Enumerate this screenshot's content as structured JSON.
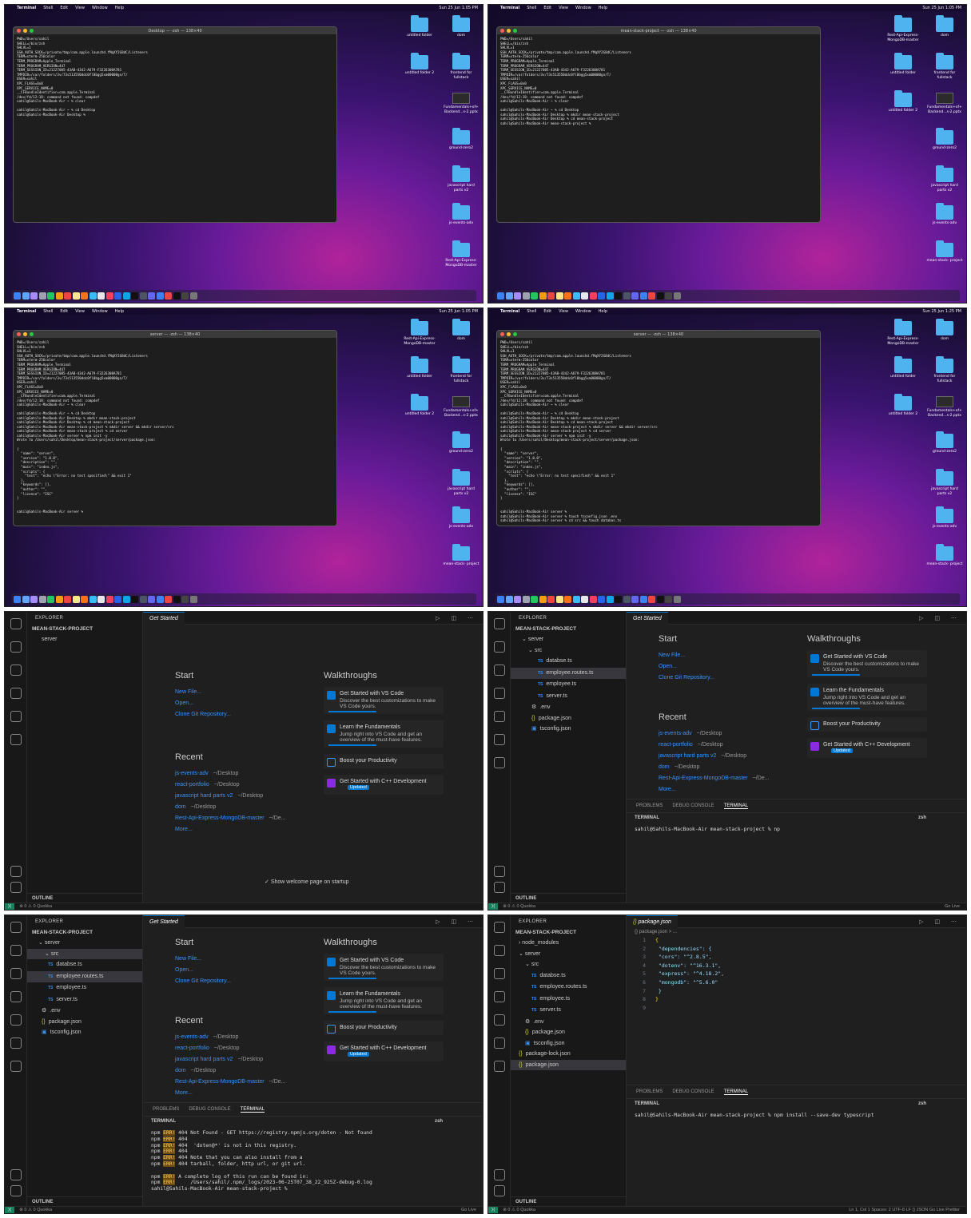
{
  "mac": {
    "menu": [
      "Terminal",
      "Shell",
      "Edit",
      "View",
      "Window",
      "Help"
    ],
    "clock": "Sun 25 Jun  1:05 PM",
    "clock2": "Sun 25 Jun  1:25 PM"
  },
  "frames": {
    "f1_title": "Desktop — -zsh — 138×40",
    "f2_title": "mean-stack-project — -zsh — 138×40",
    "f3_title": "server — -zsh — 138×40",
    "f4_title": "server — -zsh — 138×40",
    "env": "PWD=/Users/sahil\nSHELL=/bin/zsh\nSHLVL=1\nSSH_AUTH_SOCK=/private/tmp/com.apple.launchd.fMqXY2G8dC/Listeners\nTERM=xterm-256color\nTERM_PROGRAM=Apple_Terminal\nTERM_PROGRAM_VERSION=447\nTERM_SESSION_ID=21227085-43AB-4342-A679-F3226308A781\nTMPDIR=/var/folders/3v/73s513550ddc0fl0bgg5xm00000gn/T/\nUSER=sahil\nXPC_FLAGS=0x0\nXPC_SERVICE_NAME=0\n__CFBundleIdentifier=com.apple.Terminal\n/dev/fd/12:18: command not found: compdef\nsahil@Sahils-MacBook-Air ~ % clear",
    "f1_cmd": "sahil@Sahils-MacBook-Air ~ % cd Desktop\nsahil@Sahils-MacBook-Air Desktop % ",
    "f2_cmd": "sahil@Sahils-MacBook-Air ~ % cd Desktop\nsahil@Sahils-MacBook-Air Desktop % mkdir mean-stack-project\nsahil@Sahils-MacBook-Air Desktop % cd mean-stack-project\nsahil@Sahils-MacBook-Air mean-stack-project % ",
    "f3_cmd": "sahil@Sahils-MacBook-Air ~ % cd Desktop\nsahil@Sahils-MacBook-Air Desktop % mkdir mean-stack-project\nsahil@Sahils-MacBook-Air Desktop % cd mean-stack-project\nsahil@Sahils-MacBook-Air mean-stack-project % mkdir server && mkdir server/src\nsahil@Sahils-MacBook-Air mean-stack-project % cd server\nsahil@Sahils-MacBook-Air server % npm init -y\nWrote to /Users/sahil/Desktop/mean-stack-project/server/package.json:\n\n{\n  \"name\": \"server\",\n  \"version\": \"1.0.0\",\n  \"description\": \"\",\n  \"main\": \"index.js\",\n  \"scripts\": {\n    \"test\": \"echo \\\"Error: no test specified\\\" && exit 1\"\n  },\n  \"keywords\": [],\n  \"author\": \"\",\n  \"license\": \"ISC\"\n}\n\n\nsahil@Sahils-MacBook-Air server % ",
    "f4_extra": "sahil@Sahils-MacBook-Air server % touch tsconfig.json .env\nsahil@Sahils-MacBook-Air server % cd src && touch databas.ts"
  },
  "desktop": {
    "a": [
      "untitled folder",
      "dom",
      "untitled folder 2",
      "frontend for fullstack",
      "Fundamentals+of+ Backend...s-2.pptx",
      "ground-zero2",
      "javascript hard parts v2",
      "js-events-adv",
      "Rest-Api-Express- MongoDB-master"
    ],
    "b": [
      "Rest-Api-Express- MongoDB-master",
      "dom",
      "untitled folder",
      "frontend for fullstack",
      "untitled folder 2",
      "Fundamentals+of+ Backend...s-2.pptx",
      "ground-zero2",
      "javascript hard parts v2",
      "js-events-adv",
      "mean-stack- project"
    ]
  },
  "vscode": {
    "explorer": "EXPLORER",
    "project": "MEAN-STACK-PROJECT",
    "tab": "Get Started",
    "tab2": "package.json",
    "outline": "OUTLINE",
    "server": "server",
    "src": "src",
    "node_modules": "node_modules",
    "files": [
      "databse.ts",
      "employee.routes.ts",
      "employee.ts",
      "server.ts"
    ],
    "env": ".env",
    "pkg": "package.json",
    "tsconfig": "tsconfig.json",
    "lock": "package-lock.json",
    "start": "Start",
    "new_file": "New File...",
    "open": "Open...",
    "clone": "Clone Git Repository...",
    "recent": "Recent",
    "recent_items": [
      [
        "js-events-adv",
        "~/Desktop"
      ],
      [
        "react-portfolio",
        "~/Desktop"
      ],
      [
        "javascript hard parts v2",
        "~/Desktop"
      ],
      [
        "dom",
        "~/Desktop"
      ],
      [
        "Rest-Api-Express-MongoDB-master",
        "~/De..."
      ]
    ],
    "more": "More...",
    "walk": "Walkthroughs",
    "c1t": "Get Started with VS Code",
    "c1d": "Discover the best customizations to make VS Code yours.",
    "c2t": "Learn the Fundamentals",
    "c2d": "Jump right into VS Code and get an overview of the must-have features.",
    "c3t": "Boost your Productivity",
    "c4t": "Get Started with C++ Development",
    "upd": "Updated",
    "show": "Show welcome page on startup",
    "ptabs": [
      "PROBLEMS",
      "DEBUG CONSOLE",
      "TERMINAL"
    ],
    "terminal": "TERMINAL",
    "zsh": "zsh",
    "t6": "sahil@Sahils-MacBook-Air mean-stack-project % np",
    "t7a": "404 Not Found - GET https://registry.npmjs.org/doten - Not found",
    "t7b": "404",
    "t7c": "404  'doten@*' is not in this registry.",
    "t7d": "404",
    "t7e": "404 Note that you can also install from a",
    "t7f": "404 tarball, folder, http url, or git url.",
    "t7g": "A complete log of this run can be found in:",
    "t7h": "    /Users/sahil/.npm/_logs/2023-06-25T07_38_22_925Z-debug-0.log",
    "t7i": "sahil@Sahils-MacBook-Air mean-stack-project % ",
    "npm": "npm",
    "errtag": "ERR!",
    "t8": "sahil@Sahils-MacBook-Air mean-stack-project % npm install --save-dev typescript ",
    "bc": "{} package.json > ...",
    "status_l": "⊗ 0  ⚠ 0     Quokka",
    "status_r": "Go Live",
    "status_r8": "Ln 1, Col 1   Spaces: 2   UTF-8   LF   {} JSON   Go Live   Prettier"
  },
  "pkgjson": [
    "{",
    "  \"dependencies\": {",
    "    \"cors\": \"^2.8.5\",",
    "    \"dotenv\": \"^16.3.1\",",
    "    \"express\": \"^4.18.2\",",
    "    \"mongodb\": \"^5.6.0\"",
    "  }",
    "}",
    ""
  ]
}
